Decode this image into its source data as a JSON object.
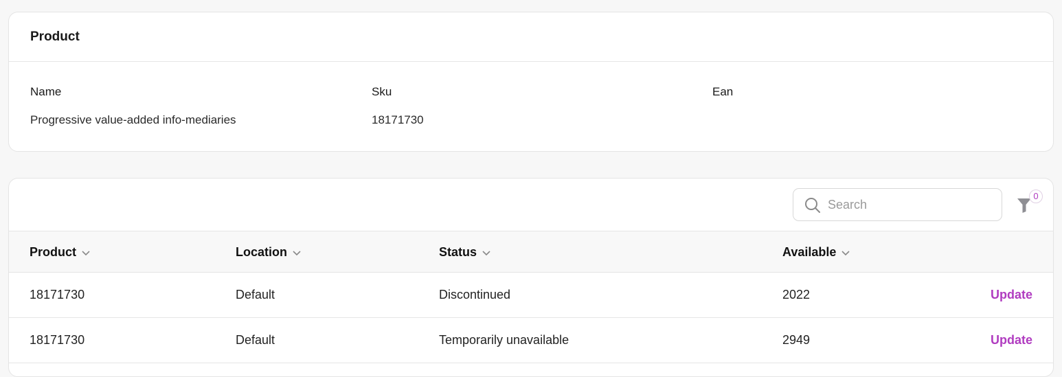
{
  "product_card": {
    "title": "Product",
    "fields": [
      {
        "label": "Name",
        "value": "Progressive value-added info-mediaries"
      },
      {
        "label": "Sku",
        "value": "18171730"
      },
      {
        "label": "Ean",
        "value": ""
      }
    ]
  },
  "toolbar": {
    "search_placeholder": "Search",
    "filter_count": "0"
  },
  "table": {
    "columns": [
      "Product",
      "Location",
      "Status",
      "Available"
    ],
    "rows": [
      {
        "product": "18171730",
        "location": "Default",
        "status": "Discontinued",
        "available": "2022",
        "action": "Update"
      },
      {
        "product": "18171730",
        "location": "Default",
        "status": "Temporarily unavailable",
        "available": "2949",
        "action": "Update"
      }
    ]
  },
  "colors": {
    "accent": "#b03cc0",
    "background": "#f7f7f7"
  }
}
